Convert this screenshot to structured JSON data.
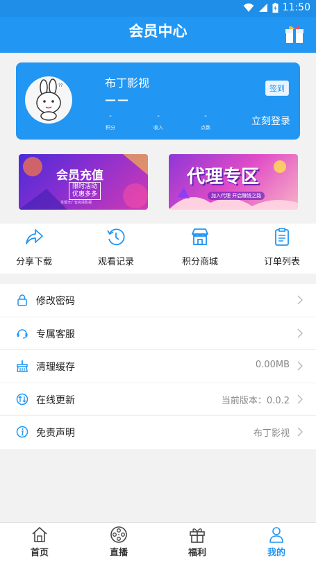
{
  "status_bar": {
    "time": "11:50"
  },
  "header": {
    "title": "会员中心",
    "gift_icon": "gift-icon"
  },
  "profile": {
    "name": "布丁影视",
    "placeholder_dash": "——",
    "checkin_label": "签到",
    "login_label": "立刻登录",
    "stats": [
      {
        "value": "-",
        "label": "积分"
      },
      {
        "value": "-",
        "label": "收入"
      },
      {
        "value": "-",
        "label": "点数"
      }
    ]
  },
  "banners": [
    {
      "title": "会员充值",
      "tag_line1": "限时活动",
      "tag_line2": "优惠多多",
      "subtext": "享受无广告高清影视"
    },
    {
      "title": "代理专区",
      "subtext": "加入代理 开启赚钱之路"
    }
  ],
  "quick_actions": [
    {
      "label": "分享下载",
      "icon": "share-icon"
    },
    {
      "label": "观看记录",
      "icon": "history-icon"
    },
    {
      "label": "积分商城",
      "icon": "store-icon"
    },
    {
      "label": "订单列表",
      "icon": "order-list-icon"
    }
  ],
  "menu": [
    {
      "label": "修改密码",
      "value": "",
      "icon": "lock-icon"
    },
    {
      "label": "专属客服",
      "value": "",
      "icon": "customer-service-icon"
    },
    {
      "label": "清理缓存",
      "value": "0.00MB",
      "icon": "clean-cache-icon"
    },
    {
      "label": "在线更新",
      "value": "当前版本：0.0.2",
      "icon": "update-icon"
    },
    {
      "label": "免责声明",
      "value": "布丁影视",
      "icon": "info-icon"
    }
  ],
  "tabs": [
    {
      "label": "首页",
      "icon": "home-icon"
    },
    {
      "label": "直播",
      "icon": "film-reel-icon"
    },
    {
      "label": "福利",
      "icon": "gift-icon"
    },
    {
      "label": "我的",
      "icon": "user-icon",
      "active": true
    }
  ],
  "colors": {
    "primary": "#2196f3",
    "background": "#f2f2f2"
  }
}
